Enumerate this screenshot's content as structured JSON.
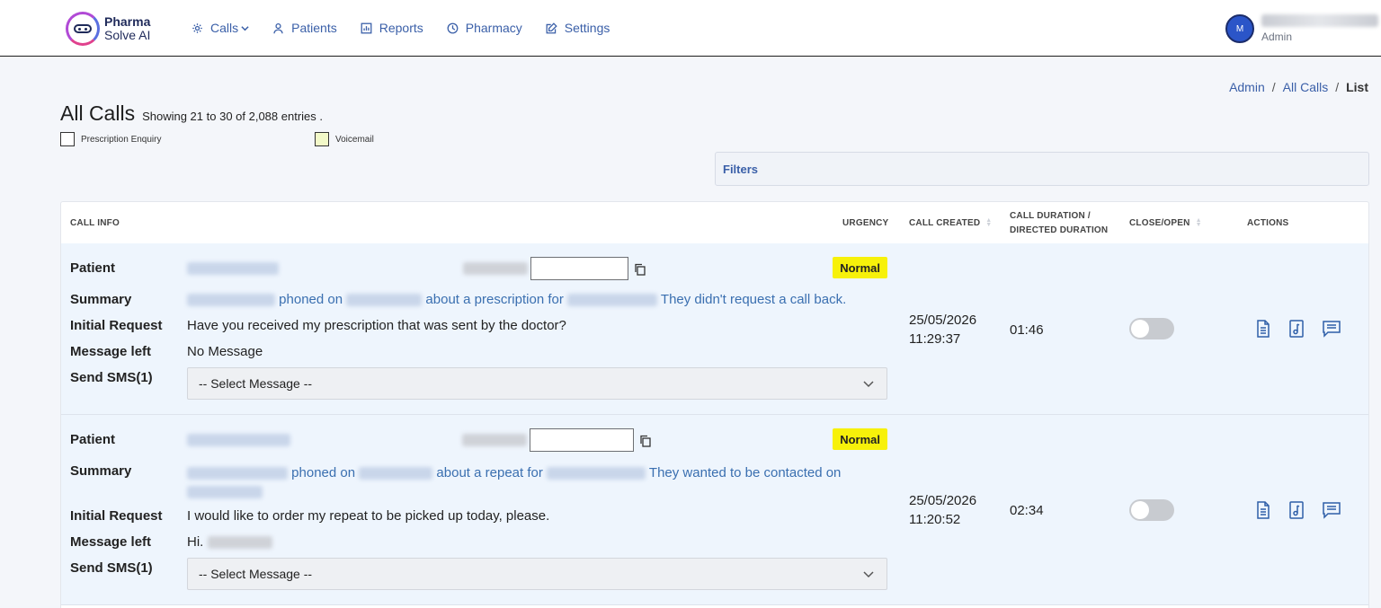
{
  "app": {
    "logo_line1": "Pharma",
    "logo_line2": "Solve AI"
  },
  "nav": [
    {
      "label": "Calls",
      "icon": "gear-icon"
    },
    {
      "label": "Patients",
      "icon": "user-icon"
    },
    {
      "label": "Reports",
      "icon": "bar-chart-icon"
    },
    {
      "label": "Pharmacy",
      "icon": "clock-icon"
    },
    {
      "label": "Settings",
      "icon": "edit-icon"
    }
  ],
  "user": {
    "initial": "M",
    "role": "Admin"
  },
  "breadcrumb": {
    "item1": "Admin",
    "item2": "All Calls",
    "current": "List",
    "sep": "/"
  },
  "page": {
    "title": "All Calls",
    "entries": "Showing 21 to 30 of 2,088 entries ."
  },
  "legend": [
    {
      "label": "Prescription Enquiry",
      "color": "#ffffff"
    },
    {
      "label": "Voicemail",
      "color": "#f2f9c8"
    }
  ],
  "filters_label": "Filters",
  "columns": {
    "call_info": "CALL INFO",
    "urgency": "URGENCY",
    "call_created": "CALL CREATED",
    "duration_line1": "CALL DURATION /",
    "duration_line2": "DIRECTED DURATION",
    "close_open": "CLOSE/OPEN",
    "actions": "ACTIONS"
  },
  "labels": {
    "patient": "Patient",
    "summary": "Summary",
    "initial_request": "Initial Request",
    "message_left": "Message left",
    "send_sms": "Send SMS(1)"
  },
  "rows": [
    {
      "urgency": "Normal",
      "summary_a": "phoned on",
      "summary_b": "about a prescription for",
      "summary_c": "They didn't request a call back.",
      "initial_request": "Have you received my prescription that was sent by the doctor?",
      "message_left": "No Message",
      "sms_placeholder": "-- Select Message --",
      "date": "25/05/2026",
      "time": "11:29:37",
      "duration": "01:46",
      "closed": false
    },
    {
      "urgency": "Normal",
      "summary_a": "phoned on",
      "summary_b": "about a repeat for",
      "summary_c": "They wanted to be contacted on",
      "initial_request": "I would like to order my repeat to be picked up today, please.",
      "message_left": "Hi.",
      "sms_placeholder": "-- Select Message --",
      "date": "25/05/2026",
      "time": "11:20:52",
      "duration": "02:34",
      "closed": false
    }
  ]
}
